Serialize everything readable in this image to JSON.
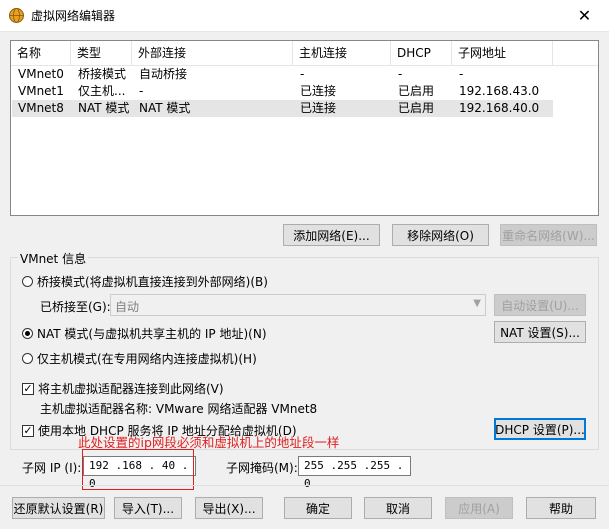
{
  "window": {
    "title": "虚拟网络编辑器",
    "close_glyph": "✕"
  },
  "network_table": {
    "columns": [
      "名称",
      "类型",
      "外部连接",
      "主机连接",
      "DHCP",
      "子网地址"
    ],
    "rows": [
      {
        "name": "VMnet0",
        "type": "桥接模式",
        "external": "自动桥接",
        "host": "-",
        "dhcp": "-",
        "subnet": "-"
      },
      {
        "name": "VMnet1",
        "type": "仅主机...",
        "external": "-",
        "host": "已连接",
        "dhcp": "已启用",
        "subnet": "192.168.43.0"
      },
      {
        "name": "VMnet8",
        "type": "NAT 模式",
        "external": "NAT 模式",
        "host": "已连接",
        "dhcp": "已启用",
        "subnet": "192.168.40.0"
      }
    ],
    "selected_row": "VMnet8"
  },
  "network_buttons": {
    "add": "添加网络(E)...",
    "remove": "移除网络(O)",
    "rename": "重命名网络(W)..."
  },
  "vmnet_info": {
    "group_title": "VMnet 信息",
    "bridged_radio": "桥接模式(将虚拟机直接连接到外部网络)(B)",
    "bridged_to_label": "已桥接至(G):",
    "bridged_to_value": "自动",
    "auto_settings": "自动设置(U)...",
    "nat_radio": "NAT 模式(与虚拟机共享主机的 IP 地址)(N)",
    "nat_settings": "NAT 设置(S)...",
    "hostonly_radio": "仅主机模式(在专用网络内连接虚拟机)(H)",
    "selected_mode": "nat",
    "connect_adapter_check": "将主机虚拟适配器连接到此网络(V)",
    "connect_adapter_checked": true,
    "adapter_name": "主机虚拟适配器名称: VMware 网络适配器 VMnet8",
    "dhcp_check": "使用本地 DHCP 服务将 IP 地址分配给虚拟机(D)",
    "dhcp_checked": true,
    "dhcp_settings": "DHCP 设置(P)...",
    "subnet_ip_label": "子网 IP (I):",
    "subnet_ip_value": "192 .168 . 40  . 0",
    "subnet_mask_label": "子网掩码(M):",
    "subnet_mask_value": "255 .255 .255 . 0"
  },
  "annotation": {
    "text": "此处设置的ip网段必须和虚拟机上的地址段一样",
    "color": "#e02020"
  },
  "bottom_buttons": {
    "restore": "还原默认设置(R)",
    "import": "导入(T)...",
    "export": "导出(X)...",
    "ok": "确定",
    "cancel": "取消",
    "apply": "应用(A)",
    "help": "帮助"
  }
}
